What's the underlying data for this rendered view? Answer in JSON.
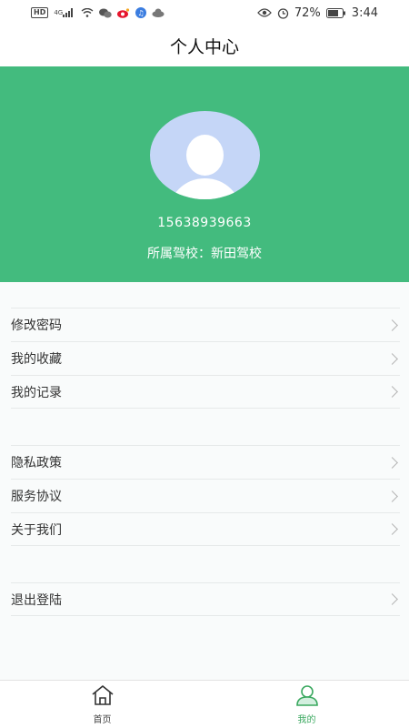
{
  "status_bar": {
    "network_badge": "HD",
    "signal_text": "4G",
    "battery_percent": "72%",
    "time": "3:44"
  },
  "header": {
    "title": "个人中心"
  },
  "profile": {
    "phone": "15638939663",
    "school": "所属驾校：新田驾校"
  },
  "menu": {
    "group1": [
      {
        "label": "修改密码"
      },
      {
        "label": "我的收藏"
      },
      {
        "label": "我的记录"
      }
    ],
    "group2": [
      {
        "label": "隐私政策"
      },
      {
        "label": "服务协议"
      },
      {
        "label": "关于我们"
      }
    ],
    "group3": [
      {
        "label": "退出登陆"
      }
    ]
  },
  "tabs": [
    {
      "label": "首页",
      "icon": "home-icon",
      "active": false
    },
    {
      "label": "我的",
      "icon": "person-icon",
      "active": true
    }
  ],
  "colors": {
    "accent": "#43bb7e",
    "tab_active": "#3aa85f"
  }
}
